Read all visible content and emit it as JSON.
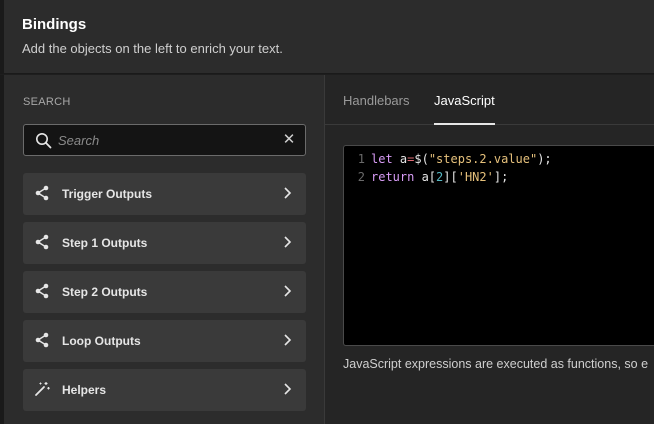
{
  "header": {
    "title": "Bindings",
    "subtitle": "Add the objects on the left to enrich your text."
  },
  "sidebar": {
    "section_label": "SEARCH",
    "search_placeholder": "Search",
    "items": [
      {
        "label": "Trigger Outputs",
        "icon": "share-icon"
      },
      {
        "label": "Step 1 Outputs",
        "icon": "share-icon"
      },
      {
        "label": "Step 2 Outputs",
        "icon": "share-icon"
      },
      {
        "label": "Loop Outputs",
        "icon": "share-icon"
      },
      {
        "label": "Helpers",
        "icon": "magic-wand-icon"
      }
    ]
  },
  "tabs": [
    {
      "label": "Handlebars",
      "active": false
    },
    {
      "label": "JavaScript",
      "active": true
    }
  ],
  "editor": {
    "lines": [
      {
        "number": "1",
        "tokens": {
          "kw1": "let",
          "a1": " a",
          "op1": "=",
          "fn": "$(",
          "str1": "\"steps.2.value\"",
          "end1": ");"
        }
      },
      {
        "number": "2",
        "tokens": {
          "kw2": "return",
          "a2": " a[",
          "num": "2",
          "mid": "][",
          "str2": "'HN2'",
          "end2": "];"
        }
      }
    ]
  },
  "note": "JavaScript expressions are executed as functions, so e",
  "colors": {
    "keyword": "#d89cf6",
    "operator": "#e06c75",
    "string": "#e5c07b",
    "number": "#56b6c2"
  }
}
